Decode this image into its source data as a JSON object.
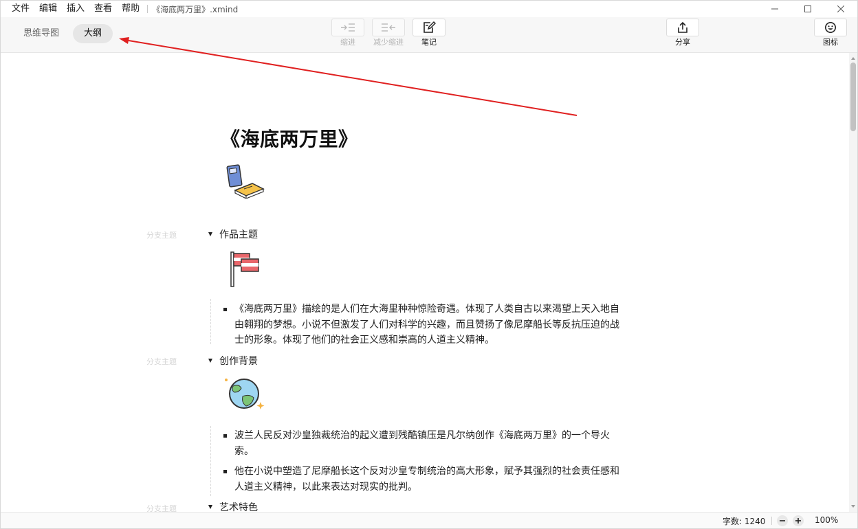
{
  "menubar": {
    "items": [
      "文件",
      "编辑",
      "插入",
      "查看",
      "帮助"
    ],
    "doc_title": "《海底两万里》.xmind"
  },
  "toolbar": {
    "view_tabs": [
      {
        "label": "思维导图",
        "active": false
      },
      {
        "label": "大纲",
        "active": true
      }
    ],
    "tools": [
      {
        "label": "缩进",
        "icon": "indent-icon",
        "enabled": false
      },
      {
        "label": "减少缩进",
        "icon": "outdent-icon",
        "enabled": false
      },
      {
        "label": "笔记",
        "icon": "note-icon",
        "enabled": true
      }
    ],
    "share_label": "分享",
    "icons_label": "图标"
  },
  "outline": {
    "title": "《海底两万里》",
    "title_sticker": "books-icon",
    "branch_hint": "分支主题",
    "branches": [
      {
        "title": "作品主题",
        "sticker": "flag-icon",
        "notes": [
          "《海底两万里》描绘的是人们在大海里种种惊险奇遇。体现了人类自古以来渴望上天入地自由翱翔的梦想。小说不但激发了人们对科学的兴趣，而且赞扬了像尼摩船长等反抗压迫的战士的形象。体现了他们的社会正义感和崇高的人道主义精神。"
        ]
      },
      {
        "title": "创作背景",
        "sticker": "globe-icon",
        "notes": [
          "波兰人民反对沙皇独裁统治的起义遭到残酷镇压是凡尔纳创作《海底两万里》的一个导火索。",
          "他在小说中塑造了尼摩船长这个反对沙皇专制统治的高大形象，赋予其强烈的社会责任感和人道主义精神，以此来表达对现实的批判。"
        ]
      },
      {
        "title": "艺术特色",
        "sticker": "",
        "notes": []
      }
    ]
  },
  "statusbar": {
    "word_count": "字数: 1240",
    "zoom": "100%"
  },
  "colors": {
    "annotation_arrow": "#e02020",
    "active_tab_bg": "#e6e6e6"
  }
}
